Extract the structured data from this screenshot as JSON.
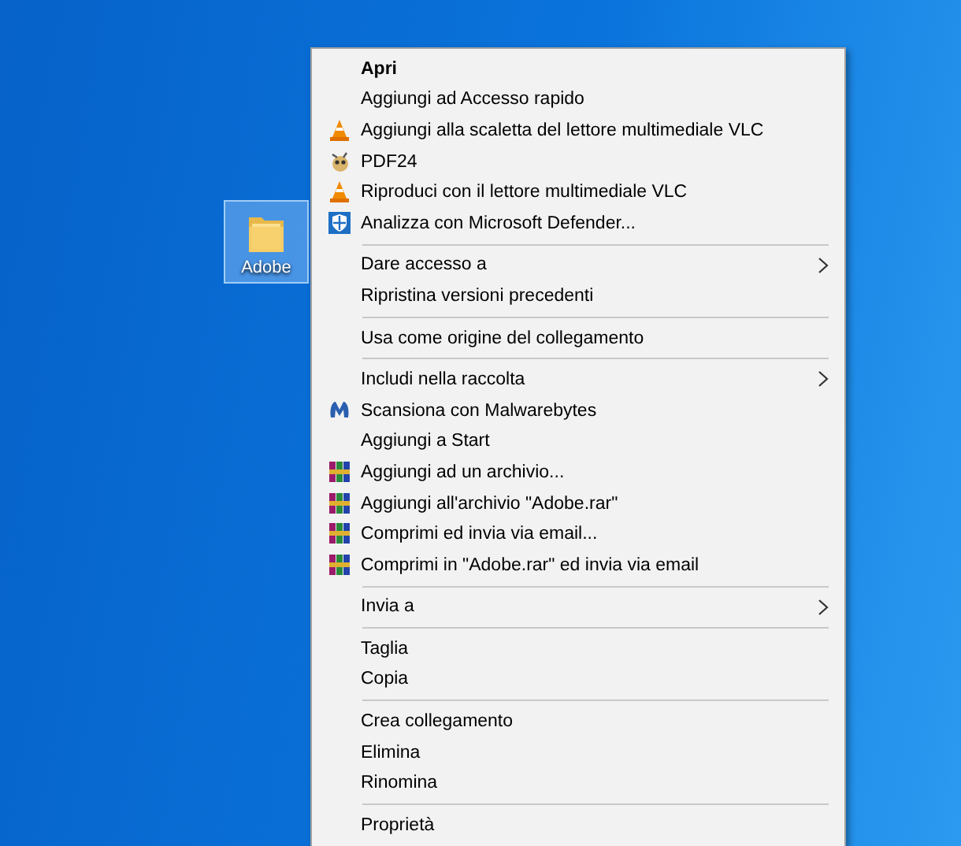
{
  "desktop_icon": {
    "label": "Adobe",
    "selected": true
  },
  "context_menu": {
    "groups": [
      [
        {
          "label": "Apri",
          "default": true
        },
        {
          "label": "Aggiungi ad Accesso rapido"
        },
        {
          "label": "Aggiungi alla scaletta del lettore multimediale VLC",
          "kind": "vlc"
        },
        {
          "label": "PDF24",
          "kind": "pdf24"
        },
        {
          "label": "Riproduci con il lettore multimediale VLC",
          "kind": "vlc"
        },
        {
          "label": "Analizza con Microsoft Defender...",
          "kind": "defender"
        }
      ],
      [
        {
          "label": "Dare accesso a",
          "submenu": true
        },
        {
          "label": "Ripristina versioni precedenti"
        }
      ],
      [
        {
          "label": "Usa come origine del collegamento"
        }
      ],
      [
        {
          "label": "Includi nella raccolta",
          "submenu": true
        },
        {
          "label": "Scansiona con Malwarebytes",
          "kind": "malwarebytes"
        },
        {
          "label": "Aggiungi a Start"
        },
        {
          "label": "Aggiungi ad un archivio...",
          "kind": "winrar"
        },
        {
          "label": "Aggiungi all'archivio \"Adobe.rar\"",
          "kind": "winrar"
        },
        {
          "label": "Comprimi ed invia via email...",
          "kind": "winrar"
        },
        {
          "label": "Comprimi in \"Adobe.rar\" ed invia via email",
          "kind": "winrar"
        }
      ],
      [
        {
          "label": "Invia a",
          "submenu": true
        }
      ],
      [
        {
          "label": "Taglia"
        },
        {
          "label": "Copia"
        }
      ],
      [
        {
          "label": "Crea collegamento"
        },
        {
          "label": "Elimina"
        },
        {
          "label": "Rinomina"
        }
      ],
      [
        {
          "label": "Proprietà"
        }
      ]
    ]
  }
}
